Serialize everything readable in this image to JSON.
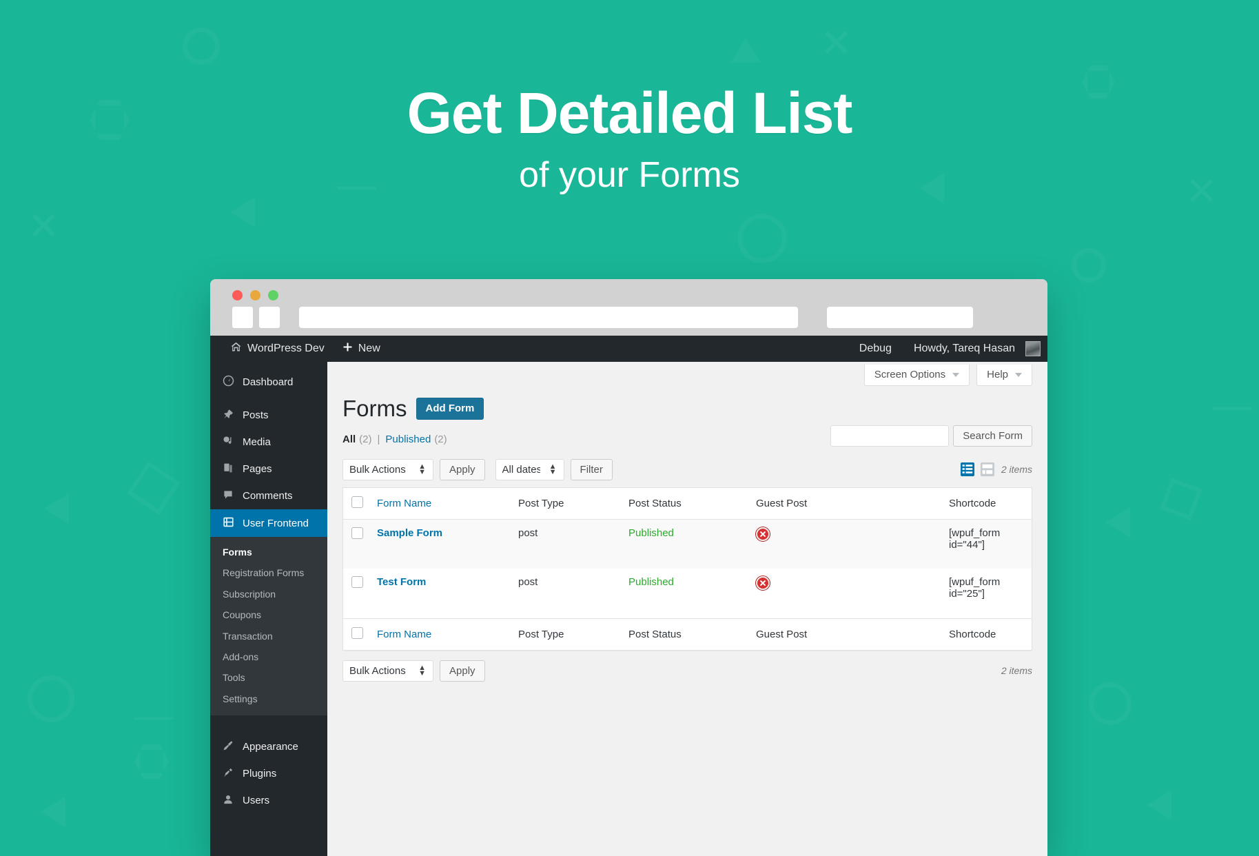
{
  "hero": {
    "title": "Get Detailed List",
    "subtitle": "of your Forms",
    "background_color": "#19b698",
    "text_color": "#ffffff"
  },
  "browser": {
    "traffic_lights": [
      "close-red",
      "minimize-yellow",
      "maximize-green"
    ],
    "url_value": "",
    "url_placeholder": "",
    "search_value": "",
    "search_placeholder": ""
  },
  "adminbar": {
    "site_icon": "home-icon",
    "site_name": "WordPress Dev",
    "new_icon": "plus-icon",
    "new_label": "New",
    "debug_label": "Debug",
    "howdy": "Howdy, Tareq Hasan",
    "avatar": "user-avatar"
  },
  "sidebar": {
    "items": [
      {
        "label": "Dashboard",
        "icon": "dashboard-icon",
        "current": false
      },
      {
        "label": "Posts",
        "icon": "pin-icon",
        "current": false
      },
      {
        "label": "Media",
        "icon": "media-icon",
        "current": false
      },
      {
        "label": "Pages",
        "icon": "pages-icon",
        "current": false
      },
      {
        "label": "Comments",
        "icon": "comment-icon",
        "current": false
      },
      {
        "label": "User Frontend",
        "icon": "user-frontend-icon",
        "current": true
      }
    ],
    "submenu": [
      {
        "label": "Forms",
        "current": true
      },
      {
        "label": "Registration Forms",
        "current": false
      },
      {
        "label": "Subscription",
        "current": false
      },
      {
        "label": "Coupons",
        "current": false
      },
      {
        "label": "Transaction",
        "current": false
      },
      {
        "label": "Add-ons",
        "current": false
      },
      {
        "label": "Tools",
        "current": false
      },
      {
        "label": "Settings",
        "current": false
      }
    ],
    "items_bottom": [
      {
        "label": "Appearance",
        "icon": "brush-icon",
        "current": false
      },
      {
        "label": "Plugins",
        "icon": "plug-icon",
        "current": false
      },
      {
        "label": "Users",
        "icon": "user-icon",
        "current": false
      }
    ]
  },
  "screen_meta": {
    "screen_options": "Screen Options",
    "help": "Help"
  },
  "page": {
    "title": "Forms",
    "add_button": "Add Form",
    "accent_color": "#1c7399"
  },
  "filters": {
    "all_label": "All",
    "all_count": "(2)",
    "separator": "|",
    "published_label": "Published",
    "published_count": "(2)"
  },
  "search": {
    "value": "",
    "placeholder": "",
    "button": "Search Form"
  },
  "tablenav_top": {
    "bulk_actions": "Bulk Actions",
    "apply": "Apply",
    "dates": "All dates",
    "filter": "Filter",
    "view_list_icon": "list-view-icon",
    "view_excerpt_icon": "excerpt-view-icon",
    "displaying_num": "2 items"
  },
  "tablenav_bottom": {
    "bulk_actions": "Bulk Actions",
    "apply": "Apply",
    "displaying_num": "2 items"
  },
  "table": {
    "columns": [
      "Form Name",
      "Post Type",
      "Post Status",
      "Guest Post",
      "Shortcode"
    ],
    "rows": [
      {
        "name": "Sample Form",
        "post_type": "post",
        "post_status": "Published",
        "guest_post": "no-icon",
        "shortcode": "[wpuf_form id=\"44\"]"
      },
      {
        "name": "Test Form",
        "post_type": "post",
        "post_status": "Published",
        "guest_post": "no-icon",
        "shortcode": "[wpuf_form id=\"25\"]"
      }
    ],
    "status_color": "#2ea82e",
    "link_color": "#0073aa"
  }
}
